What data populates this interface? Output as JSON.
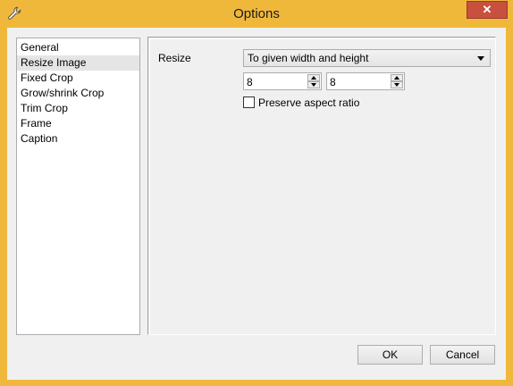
{
  "window": {
    "title": "Options",
    "close_glyph": "✕",
    "app_icon": "wrench-icon",
    "frame_color": "#f0b83b",
    "close_color": "#c7503e"
  },
  "sidebar": {
    "items": [
      {
        "label": "General"
      },
      {
        "label": "Resize Image",
        "selected": true
      },
      {
        "label": "Fixed Crop"
      },
      {
        "label": "Grow/shrink Crop"
      },
      {
        "label": "Trim Crop"
      },
      {
        "label": "Frame"
      },
      {
        "label": "Caption"
      }
    ]
  },
  "resize": {
    "label": "Resize",
    "mode_selected": "To given width and height",
    "width_value": "8",
    "height_value": "8",
    "preserve_aspect_label": "Preserve aspect ratio",
    "preserve_aspect_checked": false
  },
  "buttons": {
    "ok": "OK",
    "cancel": "Cancel"
  }
}
